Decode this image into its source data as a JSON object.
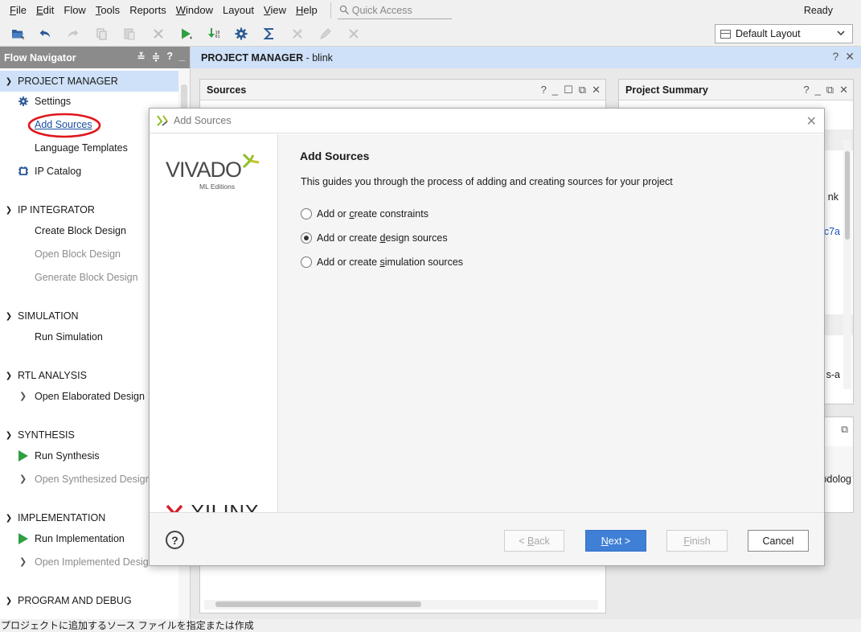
{
  "menu": {
    "items": [
      {
        "label": "File",
        "mnemonic": "F",
        "rest": "ile"
      },
      {
        "label": "Edit",
        "mnemonic": "E",
        "rest": "dit"
      },
      {
        "label": "Flow",
        "mnemonic": "",
        "rest": "Flow"
      },
      {
        "label": "Tools",
        "mnemonic": "T",
        "rest": "ools"
      },
      {
        "label": "Reports",
        "mnemonic": "",
        "rest": "Reports"
      },
      {
        "label": "Window",
        "mnemonic": "W",
        "rest": "indow"
      },
      {
        "label": "Layout",
        "mnemonic": "",
        "rest": "Layout"
      },
      {
        "label": "View",
        "mnemonic": "V",
        "rest": "iew"
      },
      {
        "label": "Help",
        "mnemonic": "H",
        "rest": "elp"
      }
    ],
    "quick_access_placeholder": "Quick Access",
    "status": "Ready"
  },
  "toolbar": {
    "layout_value": "Default Layout"
  },
  "flow_navigator": {
    "title": "Flow Navigator",
    "header_icons": "⁼ ≑ ? _",
    "sections": {
      "project_manager": "PROJECT MANAGER",
      "ip_integrator": "IP INTEGRATOR",
      "simulation": "SIMULATION",
      "rtl_analysis": "RTL ANALYSIS",
      "synthesis": "SYNTHESIS",
      "implementation": "IMPLEMENTATION",
      "program_debug": "PROGRAM AND DEBUG"
    },
    "items": {
      "settings": "Settings",
      "add_sources": "Add Sources",
      "language_templates": "Language Templates",
      "ip_catalog": "IP Catalog",
      "create_block_design": "Create Block Design",
      "open_block_design": "Open Block Design",
      "generate_block_design": "Generate Block Design",
      "run_simulation": "Run Simulation",
      "open_elaborated_design": "Open Elaborated Design",
      "run_synthesis": "Run Synthesis",
      "open_synthesized_design": "Open Synthesized Design",
      "run_implementation": "Run Implementation",
      "open_implemented_design": "Open Implemented Design"
    }
  },
  "project_header": {
    "title": "PROJECT MANAGER",
    "separator": " - ",
    "project": "blink"
  },
  "panels": {
    "sources_title": "Sources",
    "summary_title": "Project Summary",
    "summary_fragments": [
      "nk",
      "c7a",
      "s-a",
      "odolog"
    ]
  },
  "dialog": {
    "title": "Add Sources",
    "heading": "Add Sources",
    "description": "This guides you through the process of adding and creating sources for your project",
    "vivado_logo": "VIVADO",
    "vivado_sub": "ML Editions",
    "xilinx_logo": "XILINX",
    "options": [
      {
        "pre": "Add or ",
        "mnemonic": "c",
        "post": "reate constraints",
        "checked": false
      },
      {
        "pre": "Add or create ",
        "mnemonic": "d",
        "post": "esign sources",
        "checked": true
      },
      {
        "pre": "Add or create ",
        "mnemonic": "s",
        "post": "imulation sources",
        "checked": false
      }
    ],
    "buttons": {
      "back": {
        "pre": "< ",
        "mnemonic": "B",
        "post": "ack"
      },
      "next": {
        "pre": "",
        "mnemonic": "N",
        "post": "ext >"
      },
      "finish": {
        "pre": "",
        "mnemonic": "F",
        "post": "inish"
      },
      "cancel": {
        "pre": "Cancel",
        "mnemonic": "",
        "post": ""
      }
    },
    "help": "?"
  },
  "statusbar": {
    "text": "プロジェクトに追加するソース ファイルを指定または作成"
  },
  "colors": {
    "accent_blue": "#3f7fd6",
    "selection": "#cfe1f8",
    "annotation_red": "#e0161c",
    "run_green": "#2ea043",
    "vivado_green": "#8cbf26",
    "xilinx_red": "#d21f2a"
  }
}
